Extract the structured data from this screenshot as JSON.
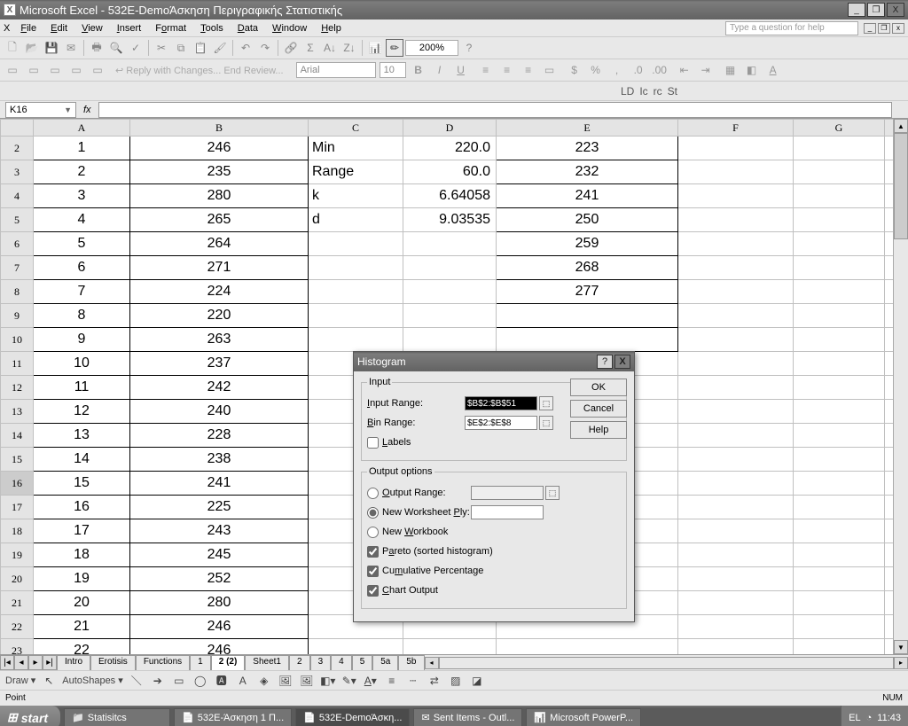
{
  "app": {
    "name": "Microsoft Excel",
    "document": "532E-DemoΆσκηση Περιγραφικής Στατιστικής"
  },
  "menus": [
    "File",
    "Edit",
    "View",
    "Insert",
    "Format",
    "Tools",
    "Data",
    "Window",
    "Help"
  ],
  "help_placeholder": "Type a question for help",
  "zoom": "200%",
  "font_name": "Arial",
  "font_size": "10",
  "ruler_icons": [
    "LD",
    "Ic",
    "rc",
    "St"
  ],
  "namebox": "K16",
  "columns": [
    "A",
    "B",
    "C",
    "D",
    "E",
    "F",
    "G"
  ],
  "rows": [
    {
      "r": "2",
      "A": "1",
      "B": "246",
      "C": "Min",
      "D": "220.0",
      "E": "223"
    },
    {
      "r": "3",
      "A": "2",
      "B": "235",
      "C": "Range",
      "D": "60.0",
      "E": "232"
    },
    {
      "r": "4",
      "A": "3",
      "B": "280",
      "C": "k",
      "D": "6.64058",
      "E": "241"
    },
    {
      "r": "5",
      "A": "4",
      "B": "265",
      "C": "d",
      "D": "9.03535",
      "E": "250"
    },
    {
      "r": "6",
      "A": "5",
      "B": "264",
      "C": "",
      "D": "",
      "E": "259"
    },
    {
      "r": "7",
      "A": "6",
      "B": "271",
      "C": "",
      "D": "",
      "E": "268"
    },
    {
      "r": "8",
      "A": "7",
      "B": "224",
      "C": "",
      "D": "",
      "E": "277"
    },
    {
      "r": "9",
      "A": "8",
      "B": "220",
      "C": "",
      "D": "",
      "E": ""
    },
    {
      "r": "10",
      "A": "9",
      "B": "263",
      "C": "",
      "D": "",
      "E": ""
    },
    {
      "r": "11",
      "A": "10",
      "B": "237",
      "C": "",
      "D": "",
      "E": ""
    },
    {
      "r": "12",
      "A": "11",
      "B": "242",
      "C": "",
      "D": "",
      "E": ""
    },
    {
      "r": "13",
      "A": "12",
      "B": "240",
      "C": "",
      "D": "",
      "E": ""
    },
    {
      "r": "14",
      "A": "13",
      "B": "228",
      "C": "",
      "D": "",
      "E": ""
    },
    {
      "r": "15",
      "A": "14",
      "B": "238",
      "C": "",
      "D": "",
      "E": ""
    },
    {
      "r": "16",
      "A": "15",
      "B": "241",
      "C": "",
      "D": "",
      "E": ""
    },
    {
      "r": "17",
      "A": "16",
      "B": "225",
      "C": "",
      "D": "",
      "E": ""
    },
    {
      "r": "18",
      "A": "17",
      "B": "243",
      "C": "",
      "D": "",
      "E": ""
    },
    {
      "r": "19",
      "A": "18",
      "B": "245",
      "C": "",
      "D": "",
      "E": ""
    },
    {
      "r": "20",
      "A": "19",
      "B": "252",
      "C": "",
      "D": "",
      "E": ""
    },
    {
      "r": "21",
      "A": "20",
      "B": "280",
      "C": "",
      "D": "",
      "E": ""
    },
    {
      "r": "22",
      "A": "21",
      "B": "246",
      "C": "",
      "D": "",
      "E": ""
    },
    {
      "r": "23",
      "A": "22",
      "B": "246",
      "C": "",
      "D": "",
      "E": ""
    }
  ],
  "tabs": [
    "Intro",
    "Erotisis",
    "Functions",
    "1",
    "2 (2)",
    "Sheet1",
    "2",
    "3",
    "4",
    "5",
    "5a",
    "5b"
  ],
  "active_tab": "2 (2)",
  "dialog": {
    "title": "Histogram",
    "group_input": "Input",
    "lbl_input_range": "Input Range:",
    "val_input_range": "$B$2:$B$51",
    "lbl_bin_range": "Bin Range:",
    "val_bin_range": "$E$2:$E$8",
    "lbl_labels": "Labels",
    "group_output": "Output options",
    "lbl_out_range": "Output Range:",
    "lbl_new_ply": "New Worksheet Ply:",
    "lbl_new_wb": "New Workbook",
    "lbl_pareto": "Pareto (sorted histogram)",
    "lbl_cum": "Cumulative Percentage",
    "lbl_chart": "Chart Output",
    "btn_ok": "OK",
    "btn_cancel": "Cancel",
    "btn_help": "Help"
  },
  "draw": {
    "label": "Draw",
    "autoshapes": "AutoShapes"
  },
  "status": {
    "mode": "Point",
    "num": "NUM"
  },
  "taskbar": {
    "start": "start",
    "tasks": [
      "Statisitcs",
      "532E-Άσκηση 1 Π...",
      "532E-DemoΆσκη...",
      "Sent Items - Outl...",
      "Microsoft PowerP..."
    ],
    "lang": "EL",
    "time": "11:43"
  }
}
